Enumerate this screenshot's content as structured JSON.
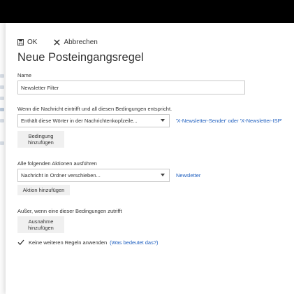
{
  "toolbar": {
    "ok_label": "OK",
    "cancel_label": "Abbrechen"
  },
  "title": "Neue Posteingangsregel",
  "name": {
    "label": "Name",
    "value": "Newsletter Filter"
  },
  "conditions": {
    "label": "Wenn die Nachricht eintrifft und all diesen Bedingungen entspricht.",
    "dropdown_value": "Enthält diese Wörter in der Nachrichtenkopfzeile...",
    "value_link": "'X-Newsletter-Sender' oder 'X-Newsletter-ISP'",
    "add_button_line1": "Bedingung",
    "add_button_line2": "hinzufügen"
  },
  "actions": {
    "label": "Alle folgenden Aktionen ausführen",
    "dropdown_value": "Nachricht in Ordner verschieben...",
    "value_link": "Newsletter",
    "add_button": "Aktion hinzufügen"
  },
  "exceptions": {
    "label": "Außer, wenn eine dieser Bedingungen zutrifft",
    "add_button_line1": "Ausnahme",
    "add_button_line2": "hinzufügen"
  },
  "stop_rules": {
    "checked": true,
    "label": "Keine weiteren Regeln anwenden",
    "help_link": "(Was bedeutet das?)"
  },
  "colors": {
    "link": "#1f5fbf",
    "button_bg": "#f0f0f0",
    "topbar": "#000000"
  }
}
